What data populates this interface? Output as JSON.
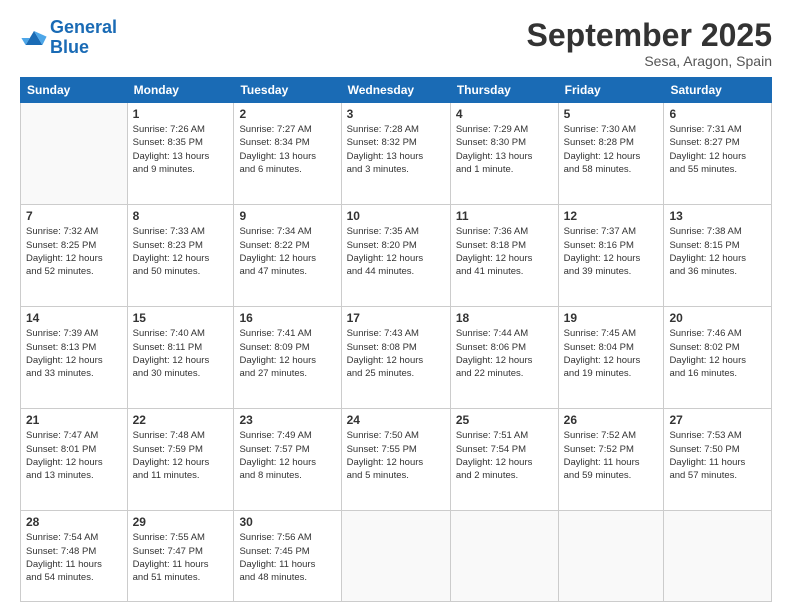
{
  "header": {
    "logo_line1": "General",
    "logo_line2": "Blue",
    "month_title": "September 2025",
    "location": "Sesa, Aragon, Spain"
  },
  "weekdays": [
    "Sunday",
    "Monday",
    "Tuesday",
    "Wednesday",
    "Thursday",
    "Friday",
    "Saturday"
  ],
  "weeks": [
    [
      {
        "day": "",
        "info": ""
      },
      {
        "day": "1",
        "info": "Sunrise: 7:26 AM\nSunset: 8:35 PM\nDaylight: 13 hours\nand 9 minutes."
      },
      {
        "day": "2",
        "info": "Sunrise: 7:27 AM\nSunset: 8:34 PM\nDaylight: 13 hours\nand 6 minutes."
      },
      {
        "day": "3",
        "info": "Sunrise: 7:28 AM\nSunset: 8:32 PM\nDaylight: 13 hours\nand 3 minutes."
      },
      {
        "day": "4",
        "info": "Sunrise: 7:29 AM\nSunset: 8:30 PM\nDaylight: 13 hours\nand 1 minute."
      },
      {
        "day": "5",
        "info": "Sunrise: 7:30 AM\nSunset: 8:28 PM\nDaylight: 12 hours\nand 58 minutes."
      },
      {
        "day": "6",
        "info": "Sunrise: 7:31 AM\nSunset: 8:27 PM\nDaylight: 12 hours\nand 55 minutes."
      }
    ],
    [
      {
        "day": "7",
        "info": "Sunrise: 7:32 AM\nSunset: 8:25 PM\nDaylight: 12 hours\nand 52 minutes."
      },
      {
        "day": "8",
        "info": "Sunrise: 7:33 AM\nSunset: 8:23 PM\nDaylight: 12 hours\nand 50 minutes."
      },
      {
        "day": "9",
        "info": "Sunrise: 7:34 AM\nSunset: 8:22 PM\nDaylight: 12 hours\nand 47 minutes."
      },
      {
        "day": "10",
        "info": "Sunrise: 7:35 AM\nSunset: 8:20 PM\nDaylight: 12 hours\nand 44 minutes."
      },
      {
        "day": "11",
        "info": "Sunrise: 7:36 AM\nSunset: 8:18 PM\nDaylight: 12 hours\nand 41 minutes."
      },
      {
        "day": "12",
        "info": "Sunrise: 7:37 AM\nSunset: 8:16 PM\nDaylight: 12 hours\nand 39 minutes."
      },
      {
        "day": "13",
        "info": "Sunrise: 7:38 AM\nSunset: 8:15 PM\nDaylight: 12 hours\nand 36 minutes."
      }
    ],
    [
      {
        "day": "14",
        "info": "Sunrise: 7:39 AM\nSunset: 8:13 PM\nDaylight: 12 hours\nand 33 minutes."
      },
      {
        "day": "15",
        "info": "Sunrise: 7:40 AM\nSunset: 8:11 PM\nDaylight: 12 hours\nand 30 minutes."
      },
      {
        "day": "16",
        "info": "Sunrise: 7:41 AM\nSunset: 8:09 PM\nDaylight: 12 hours\nand 27 minutes."
      },
      {
        "day": "17",
        "info": "Sunrise: 7:43 AM\nSunset: 8:08 PM\nDaylight: 12 hours\nand 25 minutes."
      },
      {
        "day": "18",
        "info": "Sunrise: 7:44 AM\nSunset: 8:06 PM\nDaylight: 12 hours\nand 22 minutes."
      },
      {
        "day": "19",
        "info": "Sunrise: 7:45 AM\nSunset: 8:04 PM\nDaylight: 12 hours\nand 19 minutes."
      },
      {
        "day": "20",
        "info": "Sunrise: 7:46 AM\nSunset: 8:02 PM\nDaylight: 12 hours\nand 16 minutes."
      }
    ],
    [
      {
        "day": "21",
        "info": "Sunrise: 7:47 AM\nSunset: 8:01 PM\nDaylight: 12 hours\nand 13 minutes."
      },
      {
        "day": "22",
        "info": "Sunrise: 7:48 AM\nSunset: 7:59 PM\nDaylight: 12 hours\nand 11 minutes."
      },
      {
        "day": "23",
        "info": "Sunrise: 7:49 AM\nSunset: 7:57 PM\nDaylight: 12 hours\nand 8 minutes."
      },
      {
        "day": "24",
        "info": "Sunrise: 7:50 AM\nSunset: 7:55 PM\nDaylight: 12 hours\nand 5 minutes."
      },
      {
        "day": "25",
        "info": "Sunrise: 7:51 AM\nSunset: 7:54 PM\nDaylight: 12 hours\nand 2 minutes."
      },
      {
        "day": "26",
        "info": "Sunrise: 7:52 AM\nSunset: 7:52 PM\nDaylight: 11 hours\nand 59 minutes."
      },
      {
        "day": "27",
        "info": "Sunrise: 7:53 AM\nSunset: 7:50 PM\nDaylight: 11 hours\nand 57 minutes."
      }
    ],
    [
      {
        "day": "28",
        "info": "Sunrise: 7:54 AM\nSunset: 7:48 PM\nDaylight: 11 hours\nand 54 minutes."
      },
      {
        "day": "29",
        "info": "Sunrise: 7:55 AM\nSunset: 7:47 PM\nDaylight: 11 hours\nand 51 minutes."
      },
      {
        "day": "30",
        "info": "Sunrise: 7:56 AM\nSunset: 7:45 PM\nDaylight: 11 hours\nand 48 minutes."
      },
      {
        "day": "",
        "info": ""
      },
      {
        "day": "",
        "info": ""
      },
      {
        "day": "",
        "info": ""
      },
      {
        "day": "",
        "info": ""
      }
    ]
  ]
}
